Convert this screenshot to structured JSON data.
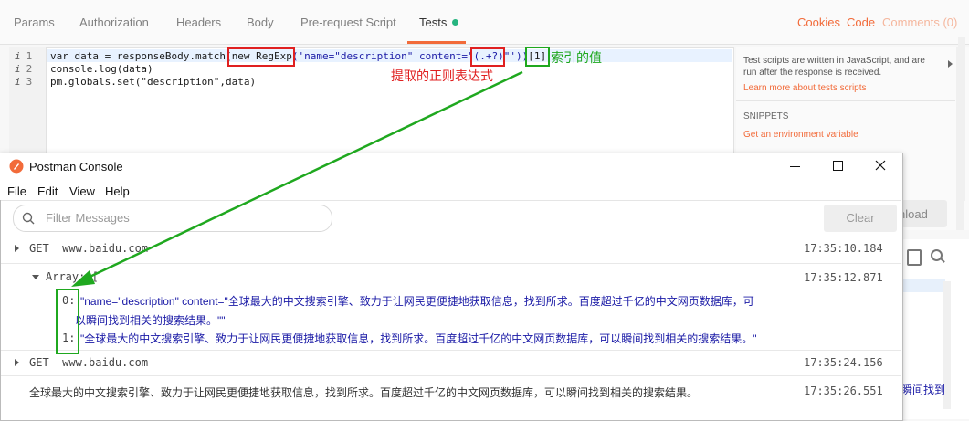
{
  "tabs": [
    {
      "label": "Params"
    },
    {
      "label": "Authorization"
    },
    {
      "label": "Headers"
    },
    {
      "label": "Body"
    },
    {
      "label": "Pre-request Script"
    },
    {
      "label": "Tests"
    }
  ],
  "tab_right": {
    "cookies": "Cookies",
    "code": "Code",
    "comments": "Comments (0)"
  },
  "editor": {
    "line_numbers": [
      "1",
      "2",
      "3"
    ],
    "info_icon": "i",
    "line1": {
      "p1": "var data = responseBody.match(",
      "p2": "new RegExp",
      "p3": "('name=\"description\" content=\"",
      "p4": "(.+?)",
      "p5": "\"'))",
      "p6": "[1]"
    },
    "line2": "console.log(data)",
    "line3": "pm.globals.set(\"description\",data)"
  },
  "annotations": {
    "index_value": "索引的值",
    "regex_label": "提取的正则表达式"
  },
  "right_panel": {
    "desc": "Test scripts are written in JavaScript, and are run after the response is received.",
    "learn_more": "Learn more about tests scripts",
    "snippets_title": "SNIPPETS",
    "snippet1": "Get an environment variable",
    "download": "nload",
    "peek_text": "瞬间找到"
  },
  "console": {
    "title": "Postman Console",
    "menu": [
      "File",
      "Edit",
      "View",
      "Help"
    ],
    "filter_placeholder": "Filter Messages",
    "clear": "Clear",
    "rows": [
      {
        "text": "GET  www.baidu.com",
        "time": "17:35:10.184"
      },
      {
        "text": "Array: [",
        "time": "17:35:12.871"
      },
      {
        "text": "GET  www.baidu.com",
        "time": "17:35:24.156"
      },
      {
        "text": "全球最大的中文搜索引擎、致力于让网民更便捷地获取信息，找到所求。百度超过千亿的中文网页数据库，可以瞬间找到相关的搜索结果。",
        "time": "17:35:26.551"
      }
    ],
    "array_items": [
      {
        "index": "0:",
        "line1": "\"name=\"description\" content=\"全球最大的中文搜索引擎、致力于让网民更便捷地获取信息，找到所求。百度超过千亿的中文网页数据库，可",
        "line2": "以瞬间找到相关的搜索结果。\"\""
      },
      {
        "index": "1:",
        "line1": "\"全球最大的中文搜索引擎、致力于让网民更便捷地获取信息，找到所求。百度超过千亿的中文网页数据库，可以瞬间找到相关的搜索结果。\""
      }
    ]
  },
  "colors": {
    "accent": "#f26b3a",
    "annotation_red": "#e02020",
    "annotation_green": "#1fa81f"
  }
}
